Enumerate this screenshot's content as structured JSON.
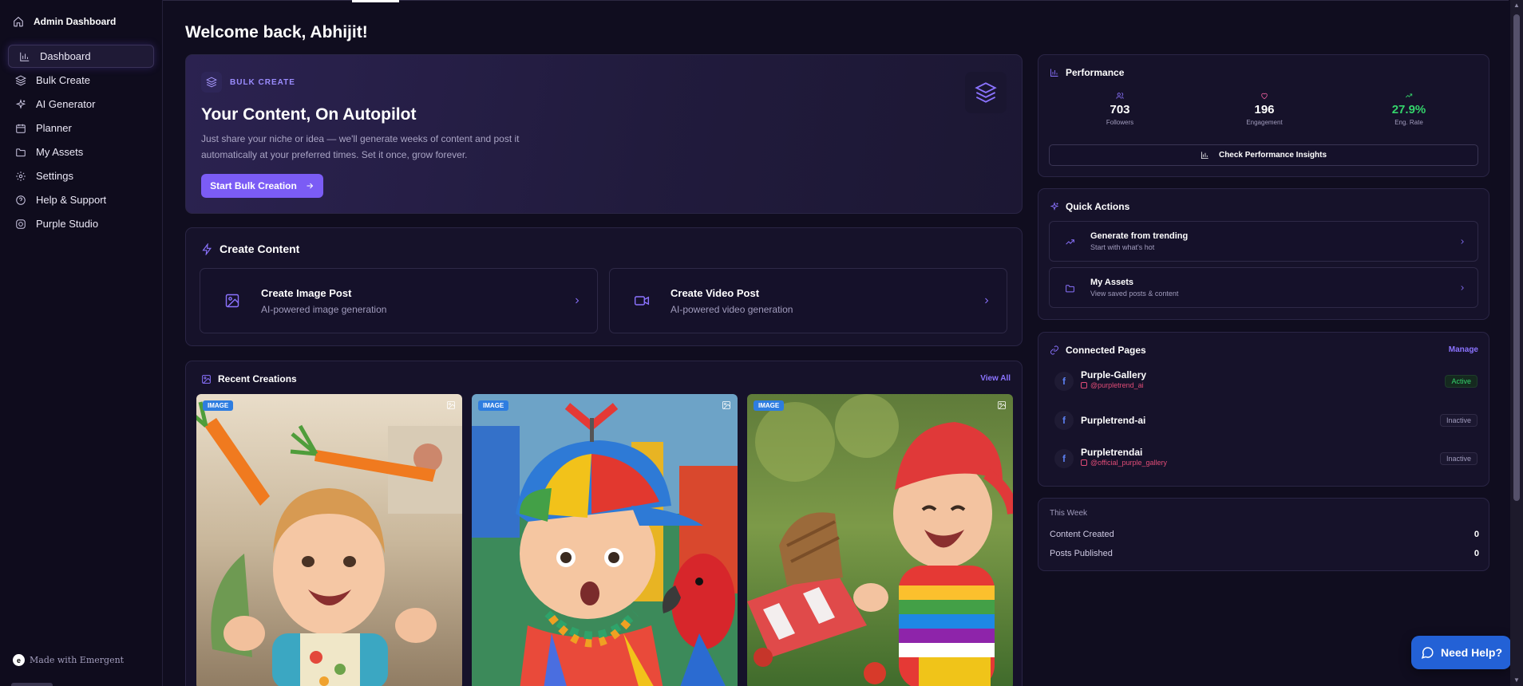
{
  "sidebar": {
    "brand": "Admin Dashboard",
    "items": [
      {
        "label": "Dashboard",
        "icon": "bar-chart-icon"
      },
      {
        "label": "Bulk Create",
        "icon": "layers-icon"
      },
      {
        "label": "AI Generator",
        "icon": "sparkles-icon"
      },
      {
        "label": "Planner",
        "icon": "calendar-icon"
      },
      {
        "label": "My Assets",
        "icon": "folder-icon"
      },
      {
        "label": "Settings",
        "icon": "gear-icon"
      },
      {
        "label": "Help & Support",
        "icon": "help-circle-icon"
      },
      {
        "label": "Purple Studio",
        "icon": "instagram-icon"
      }
    ],
    "made_with": "Made with Emergent"
  },
  "main": {
    "welcome": "Welcome back, Abhijit!",
    "hero": {
      "badge": "BULK CREATE",
      "title": "Your Content, On Autopilot",
      "description": "Just share your niche or idea — we'll generate weeks of content and post it automatically at your preferred times. Set it once, grow forever.",
      "button": "Start Bulk Creation"
    },
    "create_content": {
      "title": "Create Content",
      "options": [
        {
          "title": "Create Image Post",
          "subtitle": "AI-powered image generation"
        },
        {
          "title": "Create Video Post",
          "subtitle": "AI-powered video generation"
        }
      ]
    },
    "recent": {
      "title": "Recent Creations",
      "view_all": "View All",
      "items": [
        {
          "tag": "IMAGE",
          "subject": "Toddler laughing with carrots"
        },
        {
          "tag": "IMAGE",
          "subject": "Surprised toddler in propeller cap with parrot"
        },
        {
          "tag": "IMAGE",
          "subject": "Baby in rainbow shirt at picnic"
        }
      ]
    }
  },
  "performance": {
    "title": "Performance",
    "stats": [
      {
        "value": "703",
        "label": "Followers"
      },
      {
        "value": "196",
        "label": "Engagement"
      },
      {
        "value": "27.9%",
        "label": "Eng. Rate"
      }
    ],
    "insights_button": "Check Performance Insights"
  },
  "quick_actions": {
    "title": "Quick Actions",
    "items": [
      {
        "title": "Generate from trending",
        "subtitle": "Start with what's hot"
      },
      {
        "title": "My Assets",
        "subtitle": "View saved posts & content"
      }
    ]
  },
  "connected_pages": {
    "title": "Connected Pages",
    "manage": "Manage",
    "pages": [
      {
        "name": "Purple-Gallery",
        "handle": "@purpletrend_ai",
        "status": "Active"
      },
      {
        "name": "Purpletrend-ai",
        "handle": "",
        "status": "Inactive"
      },
      {
        "name": "Purpletrendai",
        "handle": "@official_purple_gallery",
        "status": "Inactive"
      }
    ]
  },
  "this_week": {
    "title": "This Week",
    "rows": [
      {
        "label": "Content Created",
        "value": "0"
      },
      {
        "label": "Posts Published",
        "value": "0"
      }
    ]
  },
  "help_button": "Need Help?",
  "colors": {
    "accent": "#7b5cf5",
    "background": "#100d1f",
    "success": "#34d36b",
    "help": "#2361d6"
  }
}
